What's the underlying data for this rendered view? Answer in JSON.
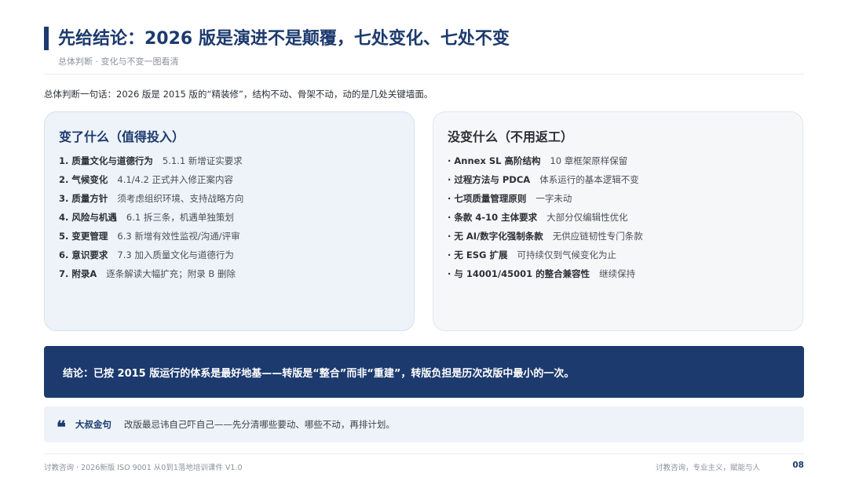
{
  "header": {
    "title": "先给结论：2026 版是演进不是颠覆，七处变化、七处不变",
    "subtitle": "总体判断 · 变化与不变一图看清"
  },
  "summary": "总体判断一句话：2026 版是 2015 版的“精装修”，结构不动、骨架不动，动的是几处关键墙面。",
  "changed": {
    "title": "变了什么（值得投入）",
    "items": [
      {
        "key": "1. 质量文化与道德行为",
        "desc": "5.1.1 新增证实要求"
      },
      {
        "key": "2. 气候变化",
        "desc": "4.1/4.2 正式并入修正案内容"
      },
      {
        "key": "3. 质量方针",
        "desc": "须考虑组织环境、支持战略方向"
      },
      {
        "key": "4. 风险与机遇",
        "desc": "6.1 拆三条，机遇单独策划"
      },
      {
        "key": "5. 变更管理",
        "desc": "6.3 新增有效性监视/沟通/评审"
      },
      {
        "key": "6. 意识要求",
        "desc": "7.3 加入质量文化与道德行为"
      },
      {
        "key": "7. 附录A",
        "desc": "逐条解读大幅扩充；附录 B 删除"
      }
    ]
  },
  "unchanged": {
    "title": "没变什么（不用返工）",
    "items": [
      {
        "key": "· Annex SL 高阶结构",
        "desc": "10 章框架原样保留"
      },
      {
        "key": "· 过程方法与 PDCA",
        "desc": "体系运行的基本逻辑不变"
      },
      {
        "key": "· 七项质量管理原则",
        "desc": "一字未动"
      },
      {
        "key": "· 条款 4-10 主体要求",
        "desc": "大部分仅编辑性优化"
      },
      {
        "key": "· 无 AI/数字化强制条款",
        "desc": "无供应链韧性专门条款"
      },
      {
        "key": "· 无 ESG 扩展",
        "desc": "可持续仅到气候变化为止"
      },
      {
        "key": "· 与 14001/45001 的整合兼容性",
        "desc": "继续保持"
      }
    ]
  },
  "conclusion": "结论：已按 2015 版运行的体系是最好地基——转版是“整合”而非“重建”，转版负担是历次改版中最小的一次。",
  "quote": {
    "icon": "quote-icon",
    "label": "大叔金句",
    "text": "改版最忌讳自己吓自己——先分清哪些要动、哪些不动，再排计划。"
  },
  "footer": {
    "left": "讨教咨询 · 2026新版 ISO 9001 从0到1落地培训课件 V1.0",
    "right": "讨教咨询，专业主义，赋能与人",
    "page": "08"
  },
  "colors": {
    "accent": "#1c3a6e",
    "left_card_bg": "#eef3f9",
    "right_card_bg": "#f6f7f9"
  }
}
